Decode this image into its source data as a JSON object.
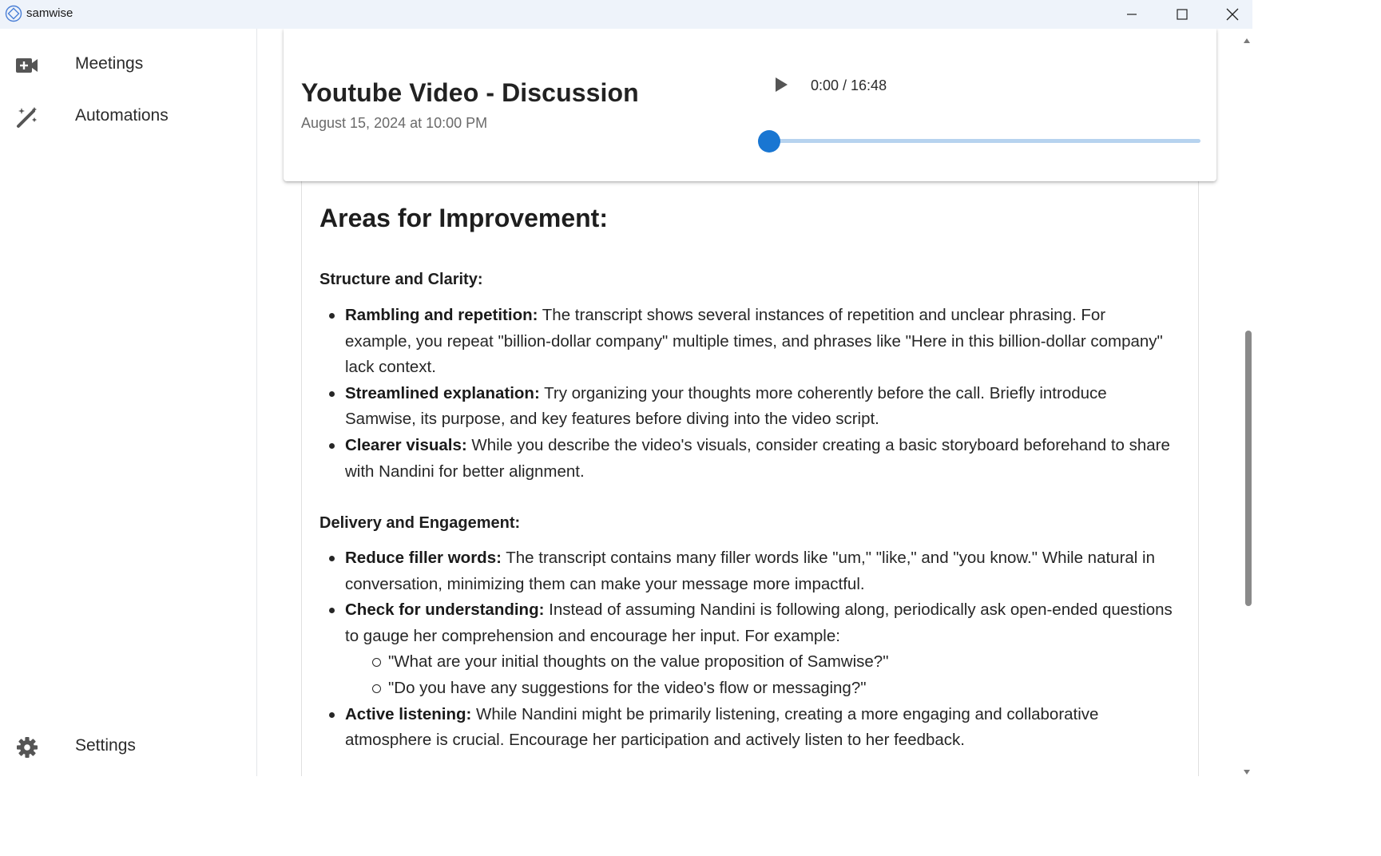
{
  "window": {
    "title": "samwise",
    "logo_icon": "samwise-logo-icon",
    "controls": [
      "minimize-icon",
      "maximize-icon",
      "close-icon"
    ]
  },
  "sidebar": {
    "items": [
      {
        "label": "Meetings",
        "icon": "video-plus-icon"
      },
      {
        "label": "Automations",
        "icon": "magic-wand-icon"
      }
    ],
    "footer": {
      "label": "Settings",
      "icon": "gear-icon"
    }
  },
  "player": {
    "title": "Youtube Video - Discussion",
    "date": "August 15, 2024 at 10:00 PM",
    "time": "0:00 / 16:48",
    "progress": 0,
    "accent": "#1976d2",
    "track_color": "#b7d3ef"
  },
  "content": {
    "heading": "Areas for Improvement:",
    "sections": [
      {
        "title": "Structure and Clarity:",
        "items": [
          {
            "label": "Rambling and repetition:",
            "text": " The transcript shows several instances of repetition and unclear phrasing. For example, you repeat \"billion-dollar company\" multiple times, and phrases like \"Here in this billion-dollar company\" lack context."
          },
          {
            "label": "Streamlined explanation:",
            "text": " Try organizing your thoughts more coherently before the call. Briefly introduce Samwise, its purpose, and key features before diving into the video script."
          },
          {
            "label": "Clearer visuals:",
            "text": " While you describe the video's visuals, consider creating a basic storyboard beforehand to share with Nandini for better alignment."
          }
        ]
      },
      {
        "title": "Delivery and Engagement:",
        "items": [
          {
            "label": "Reduce filler words:",
            "text": " The transcript contains many filler words like \"um,\" \"like,\" and \"you know.\" While natural in conversation, minimizing them can make your message more impactful."
          },
          {
            "label": "Check for understanding:",
            "text": " Instead of assuming Nandini is following along, periodically ask open-ended questions to gauge her comprehension and encourage her input. For example:",
            "subitems": [
              "\"What are your initial thoughts on the value proposition of Samwise?\"",
              "\"Do you have any suggestions for the video's flow or messaging?\""
            ]
          },
          {
            "label": "Active listening:",
            "text": " While Nandini might be primarily listening, creating a more engaging and collaborative atmosphere is crucial. Encourage her participation and actively listen to her feedback."
          }
        ]
      }
    ]
  }
}
